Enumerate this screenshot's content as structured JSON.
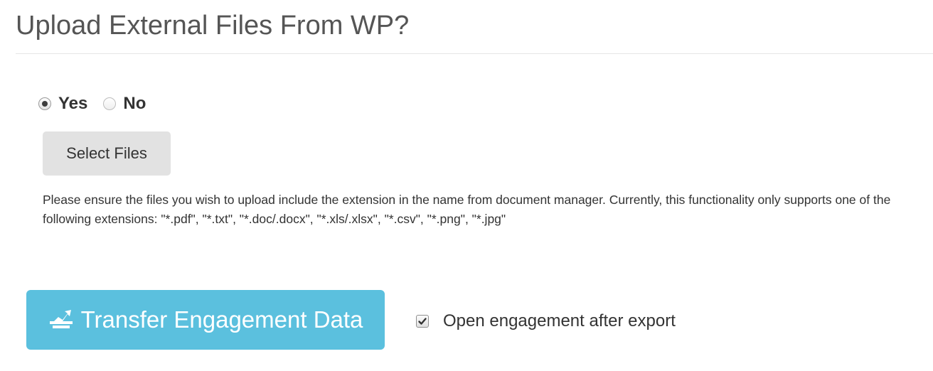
{
  "heading": {
    "title": "Upload External Files From WP?"
  },
  "upload_choice": {
    "selected": "Yes",
    "options": [
      {
        "label": "Yes",
        "checked": true
      },
      {
        "label": "No",
        "checked": false
      }
    ]
  },
  "select_files": {
    "label": "Select Files"
  },
  "help": {
    "text": "Please ensure the files you wish to upload include the extension in the name from document manager. Currently, this functionality only supports one of the following extensions: \"*.pdf\", \"*.txt\", \"*.doc/.docx\", \"*.xls/.xlsx\", \"*.csv\", \"*.png\", \"*.jpg\""
  },
  "transfer": {
    "label": "Transfer Engagement Data",
    "icon": "export-icon",
    "color": "#5bc0de"
  },
  "open_after_export": {
    "label": "Open engagement after export",
    "checked": true
  }
}
